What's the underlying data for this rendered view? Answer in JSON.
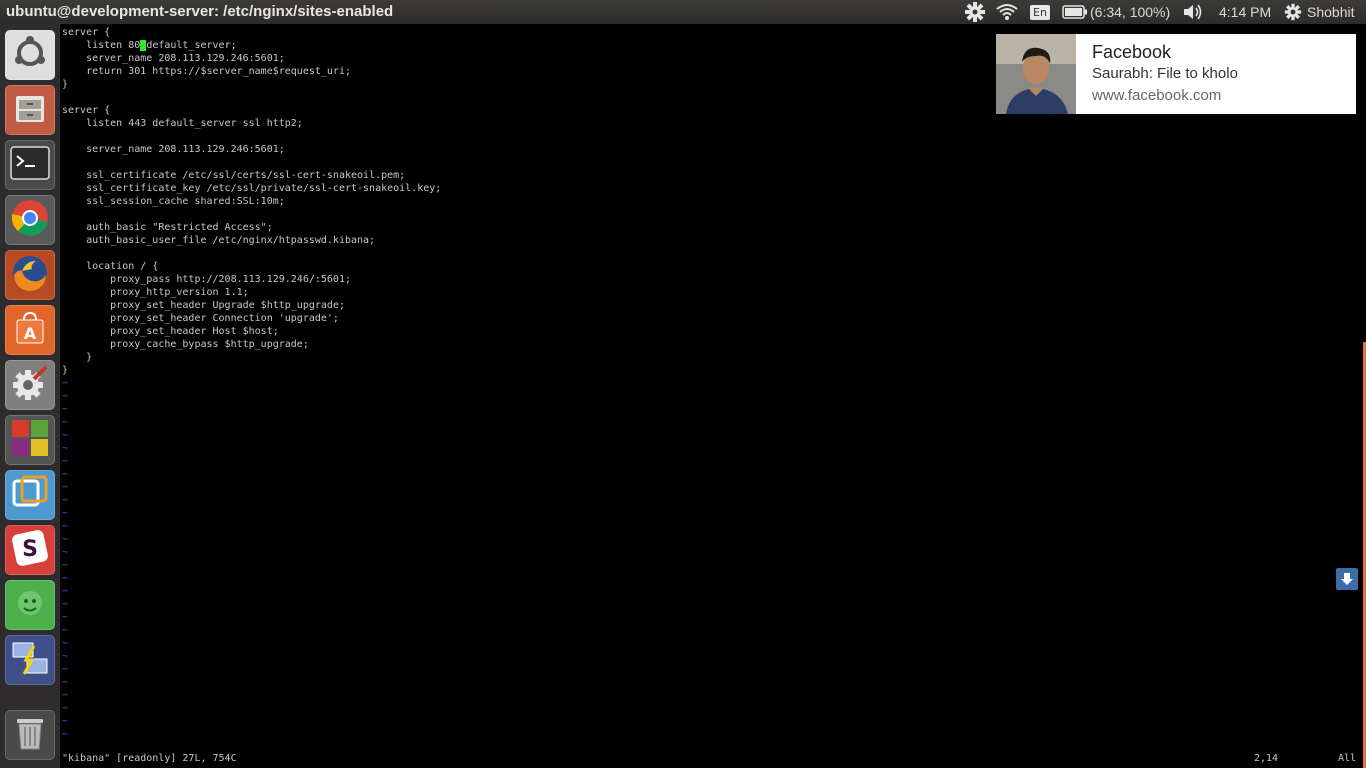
{
  "window": {
    "title": "ubuntu@development-server: /etc/nginx/sites-enabled"
  },
  "panel": {
    "battery": "(6:34, 100%)",
    "keyboard_layout": "En",
    "time": "4:14 PM",
    "user": "Shobhit",
    "icons": [
      "settings-gear-icon",
      "wifi-icon",
      "keyboard-icon",
      "battery-icon",
      "volume-icon",
      "session-gear-icon"
    ]
  },
  "launcher": {
    "items": [
      {
        "name": "ubuntu-dash",
        "color": "#dcdcdc"
      },
      {
        "name": "files",
        "color": "#c25d45"
      },
      {
        "name": "terminal",
        "color": "#4a4a4a"
      },
      {
        "name": "chrome",
        "color": "#5a5a5a"
      },
      {
        "name": "firefox",
        "color": "#c85a2b"
      },
      {
        "name": "software-center",
        "color": "#e2662a"
      },
      {
        "name": "system-settings",
        "color": "#7f7f7f"
      },
      {
        "name": "workspaces",
        "color": "#555555"
      },
      {
        "name": "vmware",
        "color": "#4d9ad0"
      },
      {
        "name": "slack",
        "color": "#d7403a"
      },
      {
        "name": "android",
        "color": "#4db04d"
      },
      {
        "name": "remote-desktop",
        "color": "#3e4f8a"
      },
      {
        "name": "trash",
        "color": "#4a4a4a"
      }
    ]
  },
  "editor": {
    "lines": [
      "server {",
      "    listen 80 default_server;",
      "    server_name 208.113.129.246:5601;",
      "    return 301 https://$server_name$request_uri;",
      "}",
      "",
      "server {",
      "    listen 443 default_server ssl http2;",
      "",
      "    server_name 208.113.129.246:5601;",
      "",
      "    ssl_certificate /etc/ssl/certs/ssl-cert-snakeoil.pem;",
      "    ssl_certificate_key /etc/ssl/private/ssl-cert-snakeoil.key;",
      "    ssl_session_cache shared:SSL:10m;",
      "",
      "    auth_basic \"Restricted Access\";",
      "    auth_basic_user_file /etc/nginx/htpasswd.kibana;",
      "",
      "    location / {",
      "        proxy_pass http://208.113.129.246/:5601;",
      "        proxy_http_version 1.1;",
      "        proxy_set_header Upgrade $http_upgrade;",
      "        proxy_set_header Connection 'upgrade';",
      "        proxy_set_header Host $host;",
      "        proxy_cache_bypass $http_upgrade;",
      "    }",
      "}"
    ],
    "status": "\"kibana\" [readonly] 27L, 754C",
    "cursor_position": "2,14",
    "scroll_indicator": "All",
    "empty_line_marker": "~"
  },
  "notification": {
    "title": "Facebook",
    "body": "Saurabh: File to kholo",
    "url": "www.facebook.com"
  }
}
